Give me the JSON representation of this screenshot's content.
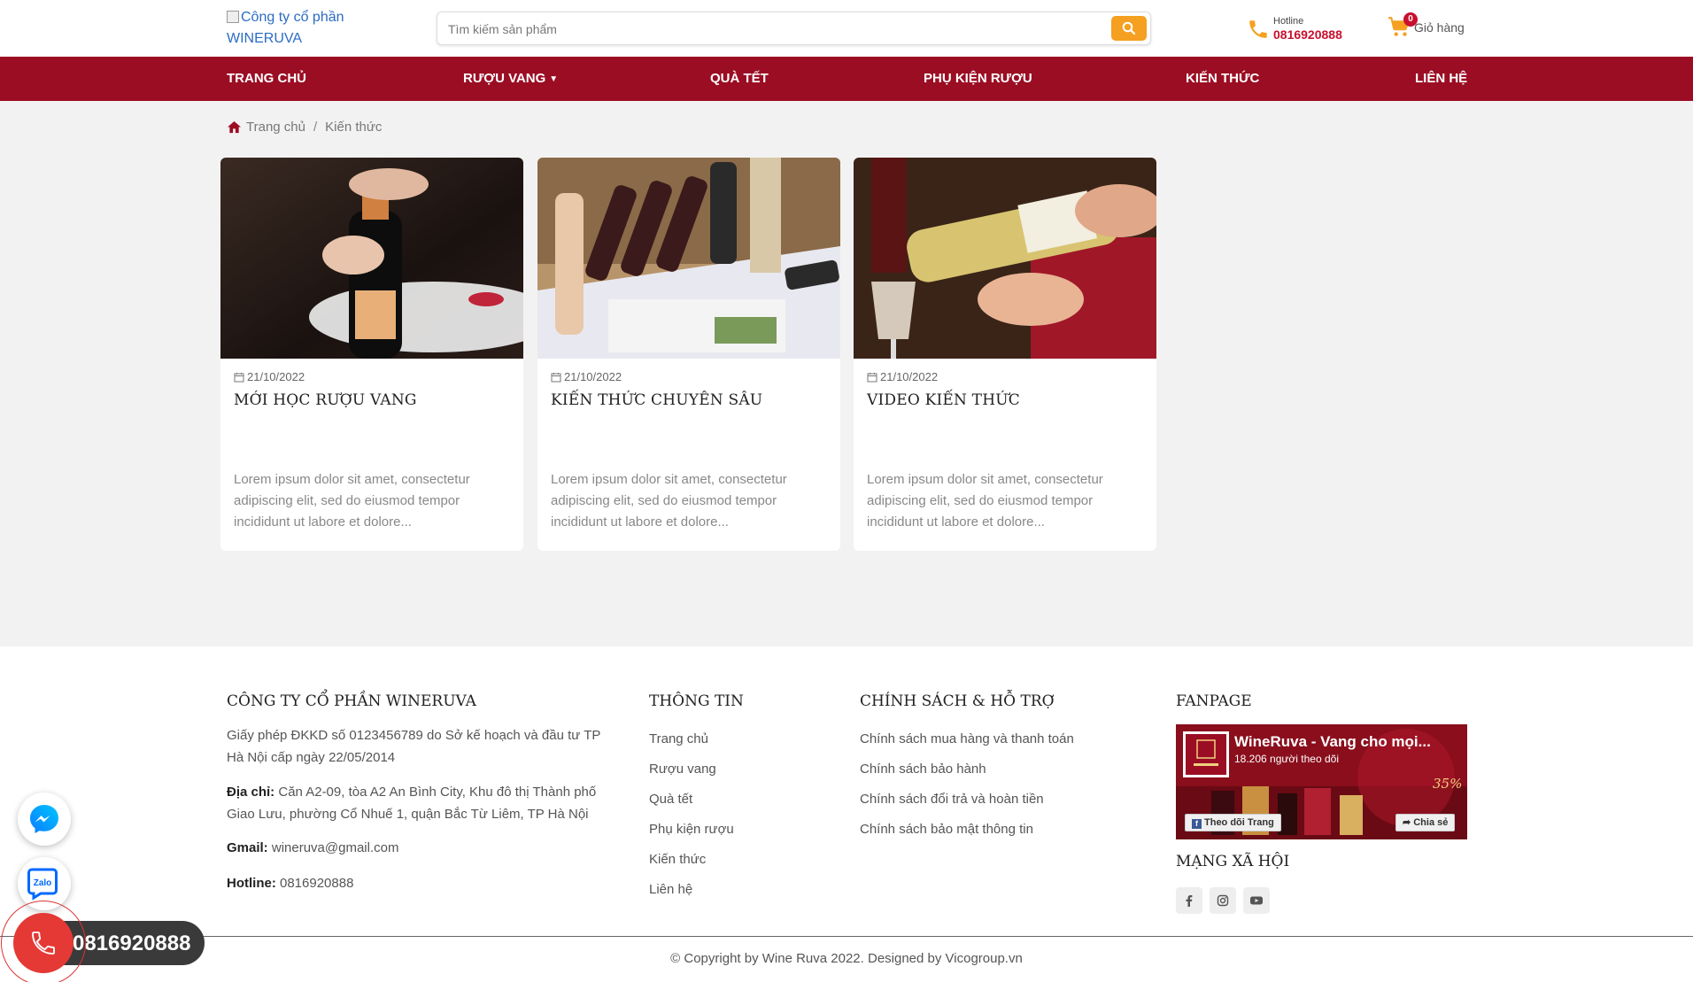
{
  "header": {
    "logo_alt": "Công ty cổ phần WINERUVA",
    "search_placeholder": "Tìm kiếm sản phẩm",
    "hotline_label": "Hotline",
    "hotline_number": "0816920888",
    "cart_count": "0",
    "cart_label": "Giỏ hàng"
  },
  "nav": {
    "items": [
      {
        "label": "TRANG CHỦ"
      },
      {
        "label": "RƯỢU VANG"
      },
      {
        "label": "QUÀ TẾT"
      },
      {
        "label": "PHỤ KIỆN RƯỢU"
      },
      {
        "label": "KIẾN THỨC"
      },
      {
        "label": "LIÊN HỆ"
      }
    ]
  },
  "breadcrumb": {
    "home": "Trang chủ",
    "separator": "/",
    "current": "Kiến thức"
  },
  "articles": [
    {
      "date": "21/10/2022",
      "title": "MỚI HỌC RƯỢU VANG",
      "excerpt": "Lorem ipsum dolor sit amet, consectetur adipiscing elit, sed do eiusmod tempor incididunt ut labore et dolore..."
    },
    {
      "date": "21/10/2022",
      "title": "KIẾN THỨC CHUYÊN SÂU",
      "excerpt": "Lorem ipsum dolor sit amet, consectetur adipiscing elit, sed do eiusmod tempor incididunt ut labore et dolore..."
    },
    {
      "date": "21/10/2022",
      "title": "VIDEO KIẾN THỨC",
      "excerpt": "Lorem ipsum dolor sit amet, consectetur adipiscing elit, sed do eiusmod tempor incididunt ut labore et dolore..."
    }
  ],
  "footer": {
    "company": {
      "title": "CÔNG TY CỔ PHẦN WINERUVA",
      "license": "Giấy phép ĐKKD số 0123456789 do Sở kế hoạch và đầu tư TP Hà Nội cấp ngày 22/05/2014",
      "address_label": "Địa chỉ:",
      "address": "Căn A2-09, tòa A2 An Bình City, Khu đô thị Thành phố Giao Lưu, phường Cổ Nhuế 1, quận Bắc Từ Liêm, TP Hà Nội",
      "email_label": "Gmail:",
      "email": "wineruva@gmail.com",
      "hotline_label": "Hotline:",
      "hotline": "0816920888"
    },
    "info": {
      "title": "THÔNG TIN",
      "links": [
        "Trang chủ",
        "Rượu vang",
        "Quà tết",
        "Phụ kiện rượu",
        "Kiến thức",
        "Liên hệ"
      ]
    },
    "policy": {
      "title": "CHÍNH SÁCH & HỖ TRỢ",
      "links": [
        "Chính sách mua hàng và thanh toán",
        "Chính sách bảo hành",
        "Chính sách đổi trả và hoàn tiền",
        "Chính sách bảo mật thông tin"
      ]
    },
    "fanpage": {
      "title": "FANPAGE",
      "page_name": "WineRuva - Vang cho mọi...",
      "followers": "18.206 người theo dõi",
      "follow_label": "Theo dõi Trang",
      "share_label": "Chia sẻ"
    },
    "social": {
      "title": "MẠNG XÃ HỘI",
      "icons": [
        "facebook-icon",
        "instagram-icon",
        "youtube-icon"
      ]
    },
    "copyright": "© Copyright by Wine Ruva 2022. Designed by Vicogroup.vn"
  },
  "floating": {
    "zalo_label": "Zalo",
    "call_number": "0816920888"
  },
  "colors": {
    "brand": "#9b0d23",
    "accent": "#f5a020",
    "hotline": "#c8102e"
  }
}
